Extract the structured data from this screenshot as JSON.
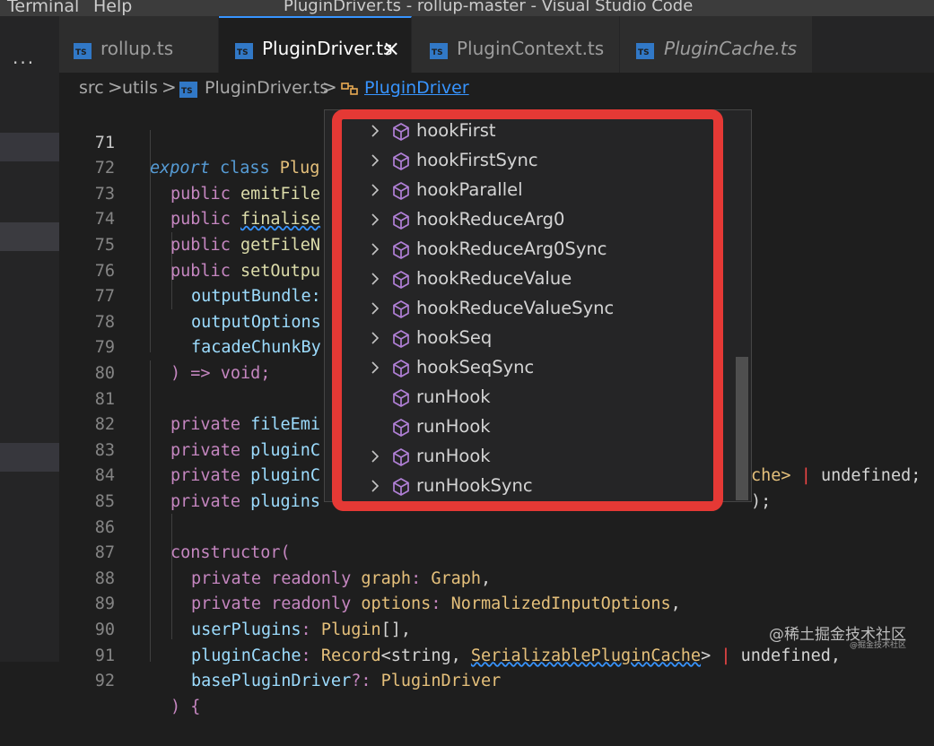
{
  "window": {
    "menu": [
      "Terminal",
      "Help"
    ],
    "title": "PluginDriver.ts - rollup-master - Visual Studio Code"
  },
  "sidebar": {
    "more_label": "···"
  },
  "tabs": [
    {
      "label": "rollup.ts",
      "icon": "TS",
      "active": false,
      "italic": false
    },
    {
      "label": "PluginDriver.ts",
      "icon": "TS",
      "active": true,
      "italic": false,
      "close": "×"
    },
    {
      "label": "PluginContext.ts",
      "icon": "TS",
      "active": false,
      "italic": false
    },
    {
      "label": "PluginCache.ts",
      "icon": "TS",
      "active": false,
      "italic": true
    }
  ],
  "breadcrumb": {
    "parts": [
      "src",
      "utils",
      "PluginDriver.ts",
      "PluginDriver"
    ],
    "separator": ">"
  },
  "editor": {
    "line_numbers": [
      "71",
      "72",
      "73",
      "74",
      "75",
      "76",
      "77",
      "78",
      "79",
      "80",
      "81",
      "82",
      "83",
      "84",
      "85",
      "86",
      "87",
      "88",
      "89",
      "90",
      "91",
      "92"
    ],
    "current_line": "71",
    "lines": {
      "l71": {
        "a": "export",
        "b": " class ",
        "c": "Plug"
      },
      "l72": {
        "a": "public ",
        "b": "emitFile"
      },
      "l73": {
        "a": "public ",
        "b": "finalise"
      },
      "l74": {
        "a": "public ",
        "b": "getFileN"
      },
      "l75": {
        "a": "public ",
        "b": "setOutpu"
      },
      "l76": {
        "a": "outputBundle:"
      },
      "l77": {
        "a": "outputOptions"
      },
      "l78": {
        "a": "facadeChunkBy"
      },
      "l79": {
        "a": ") => void;"
      },
      "l81": {
        "a": "private ",
        "b": "fileEmi"
      },
      "l82": {
        "a": "private ",
        "b": "pluginC",
        "tail_a": "che>",
        "tail_b": " | ",
        "tail_c": "undefined;"
      },
      "l83": {
        "a": "private ",
        "b": "pluginC",
        "tail_a": ");"
      },
      "l84": {
        "a": "private ",
        "b": "plugins"
      },
      "l86": {
        "a": "constructor("
      },
      "l87": {
        "a": "private readonly ",
        "b": "graph",
        "c": ": ",
        "d": "Graph",
        "e": ","
      },
      "l88": {
        "a": "private readonly ",
        "b": "options",
        "c": ": ",
        "d": "NormalizedInputOptions",
        "e": ","
      },
      "l89": {
        "a": "userPlugins",
        "b": ": ",
        "c": "Plugin",
        "d": "[],"
      },
      "l90": {
        "a": "pluginCache",
        "b": ": ",
        "c": "Record",
        "d": "<string, ",
        "e": "SerializablePluginCache",
        "f": "> ",
        "g": "|",
        "h": " undefined,"
      },
      "l91": {
        "a": "basePluginDriver",
        "b": "?: ",
        "c": "PluginDriver"
      },
      "l92": {
        "a": ") {"
      }
    }
  },
  "suggest": {
    "items": [
      {
        "label": "hookFirst",
        "expandable": true
      },
      {
        "label": "hookFirstSync",
        "expandable": true
      },
      {
        "label": "hookParallel",
        "expandable": true
      },
      {
        "label": "hookReduceArg0",
        "expandable": true
      },
      {
        "label": "hookReduceArg0Sync",
        "expandable": true
      },
      {
        "label": "hookReduceValue",
        "expandable": true
      },
      {
        "label": "hookReduceValueSync",
        "expandable": true
      },
      {
        "label": "hookSeq",
        "expandable": true
      },
      {
        "label": "hookSeqSync",
        "expandable": true
      },
      {
        "label": "runHook",
        "expandable": false
      },
      {
        "label": "runHook",
        "expandable": false
      },
      {
        "label": "runHook",
        "expandable": true
      },
      {
        "label": "runHookSync",
        "expandable": true
      }
    ],
    "icon": "method-cube-icon",
    "highlight_color": "#e53935"
  },
  "watermark": {
    "main": "@稀土掘金技术社区",
    "sub": "@掘金技术社区"
  },
  "colors": {
    "accent": "#3794ff",
    "keyword": "#c586c0",
    "function": "#dcdcaa",
    "type": "#4ec9b0"
  }
}
